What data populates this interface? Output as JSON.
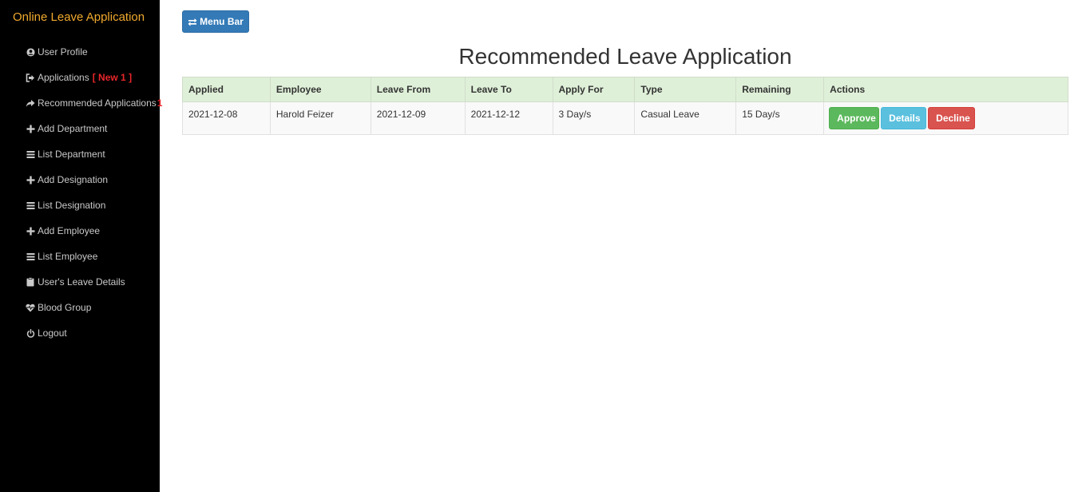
{
  "brand": "Online Leave Application",
  "sidebar": {
    "items": [
      {
        "label": "User Profile",
        "icon": "user-circle-icon"
      },
      {
        "label": "Applications",
        "icon": "sign-out-icon",
        "badge": "[ New 1 ]"
      },
      {
        "label": "Recommended Applications",
        "icon": "share-arrow-icon",
        "badge": "1"
      },
      {
        "label": "Add Department",
        "icon": "plus-icon"
      },
      {
        "label": "List Department",
        "icon": "list-icon"
      },
      {
        "label": "Add Designation",
        "icon": "plus-icon"
      },
      {
        "label": "List Designation",
        "icon": "list-icon"
      },
      {
        "label": "Add Employee",
        "icon": "plus-icon"
      },
      {
        "label": "List Employee",
        "icon": "list-icon"
      },
      {
        "label": "User's Leave Details",
        "icon": "clipboard-icon"
      },
      {
        "label": "Blood Group",
        "icon": "heartbeat-icon"
      },
      {
        "label": "Logout",
        "icon": "power-icon"
      }
    ]
  },
  "toolbar": {
    "menu_label": "Menu Bar",
    "menu_icon": "swap-arrows-icon"
  },
  "main": {
    "title": "Recommended Leave Application",
    "table": {
      "headers": [
        "Applied",
        "Employee",
        "Leave From",
        "Leave To",
        "Apply For",
        "Type",
        "Remaining",
        "Actions"
      ],
      "rows": [
        {
          "applied": "2021-12-08",
          "employee": "Harold Feizer",
          "leave_from": "2021-12-09",
          "leave_to": "2021-12-12",
          "apply_for": "3 Day/s",
          "type": "Casual Leave",
          "remaining": "15 Day/s",
          "actions": {
            "approve": "Approve",
            "details": "Details",
            "decline": "Decline"
          }
        }
      ]
    }
  },
  "colors": {
    "sidebar_bg": "#000000",
    "brand": "#f0a92e",
    "badge": "#e8262b",
    "primary": "#337ab7",
    "success": "#5cb85c",
    "info": "#5bc0de",
    "danger": "#d9534f",
    "table_header_bg": "#dff0d8"
  }
}
